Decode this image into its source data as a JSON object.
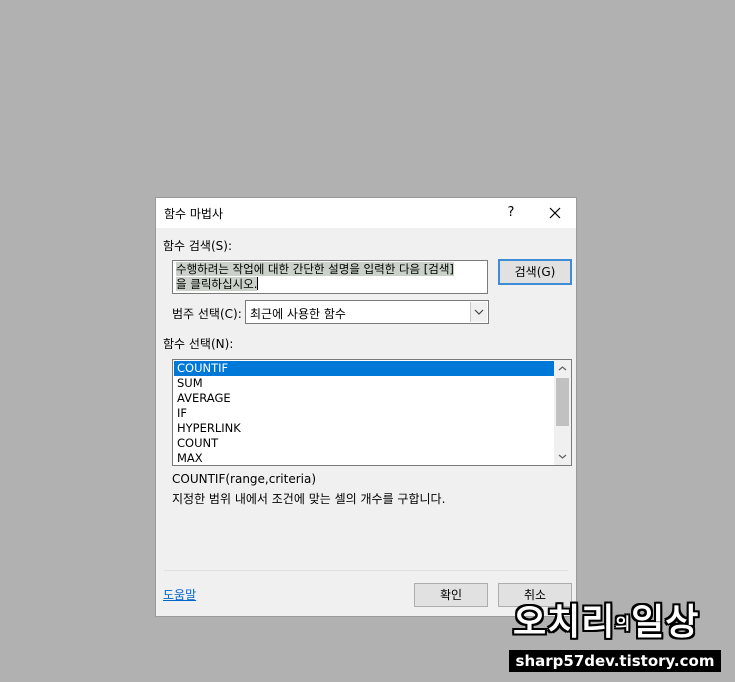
{
  "window": {
    "title": "함수 마법사",
    "help_label": "?",
    "close_icon": "close-icon"
  },
  "search": {
    "label": "함수 검색(S):",
    "text_line1": "수행하려는 작업에 대한 간단한 설명을 입력한 다음 [검색]",
    "text_line2": "을 클릭하십시오.",
    "button_label": "검색(G)"
  },
  "category": {
    "label": "범주 선택(C):",
    "selected": "최근에 사용한 함수"
  },
  "functions": {
    "label": "함수 선택(N):",
    "items": [
      "COUNTIF",
      "SUM",
      "AVERAGE",
      "IF",
      "HYPERLINK",
      "COUNT",
      "MAX"
    ],
    "selected_index": 0,
    "signature": "COUNTIF(range,criteria)",
    "description": "지정한 범위 내에서 조건에 맞는 셀의 개수를 구합니다."
  },
  "footer": {
    "help_link": "도움말",
    "ok_label": "확인",
    "cancel_label": "취소"
  },
  "watermark": {
    "title_a": "오치리",
    "title_b": "의",
    "title_c": "일상",
    "url": "sharp57dev.tistory.com"
  },
  "colors": {
    "background": "#b1b1b1",
    "selection": "#0078d7",
    "default_button_border": "#3c8dd6",
    "link": "#0066cc"
  }
}
